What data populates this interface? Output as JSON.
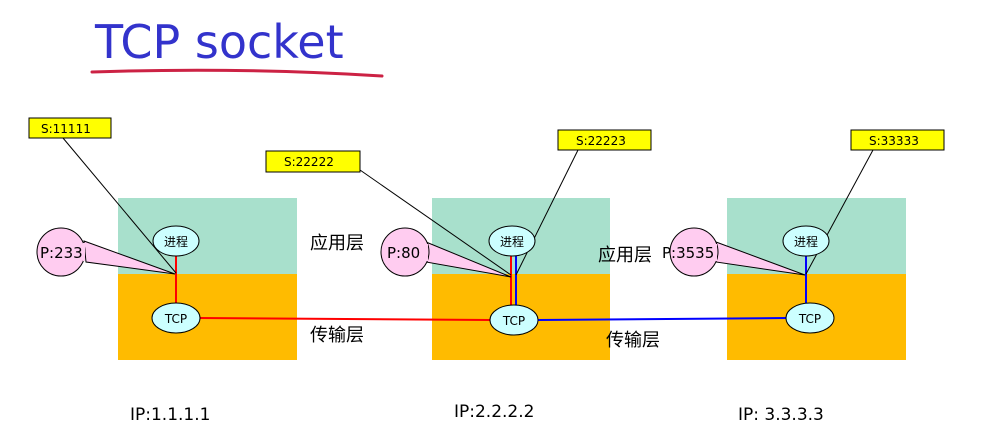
{
  "title": "TCP socket",
  "colors": {
    "title": "#3333cc",
    "underline": "#cc2244",
    "app_layer": "#a8e0cc",
    "transport_layer": "#ffbb00",
    "port_bubble": "#ffccf0",
    "socket_tag": "#ffff00",
    "node_ellipse": "#ccffff",
    "connection_red": "#ff0000",
    "connection_blue": "#0000ff"
  },
  "hosts": [
    {
      "process_label": "进程",
      "tcp_label": "TCP",
      "port_label": "P:233",
      "socket_labels": [
        "S:11111"
      ],
      "ip_label": "IP:1.1.1.1"
    },
    {
      "process_label": "进程",
      "tcp_label": "TCP",
      "port_label": "P:80",
      "socket_labels": [
        "S:22222",
        "S:22223"
      ],
      "ip_label": "IP:2.2.2.2"
    },
    {
      "process_label": "进程",
      "tcp_label": "TCP",
      "port_label": "P:3535",
      "socket_labels": [
        "S:33333"
      ],
      "ip_label": "IP: 3.3.3.3"
    }
  ],
  "layer_labels": {
    "app_1": "应用层",
    "transport_1": "传输层",
    "app_2": "应用层",
    "transport_2": "传输层"
  }
}
